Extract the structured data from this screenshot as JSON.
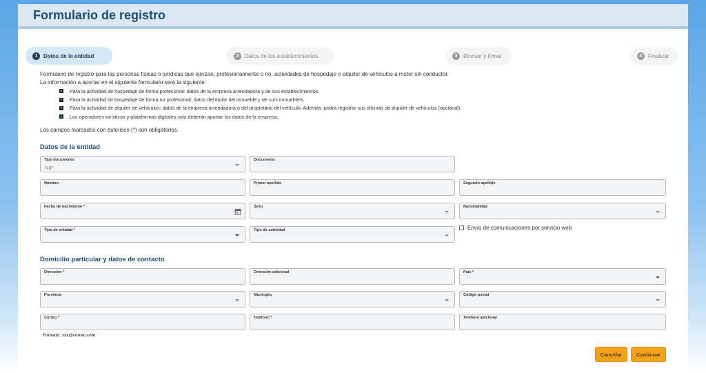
{
  "header": {
    "title": "Formulario de registro"
  },
  "stepper": [
    {
      "num": "1",
      "label": "Datos de la entidad"
    },
    {
      "num": "2",
      "label": "Datos de los establecimientos"
    },
    {
      "num": "3",
      "label": "Revisar y firmar"
    },
    {
      "num": "4",
      "label": "Finalizar"
    }
  ],
  "intro": {
    "line1": "Formulario de registro para las personas físicas o jurídicas que ejerzan, profesionalmente o no, actividades de hospedaje o alquiler de vehículos a motor sin conductor.",
    "line2": "La información a aportar en el siguiente formulario será la siguiente:",
    "bullets": [
      "Para la actividad de hospedaje de forma profesional: datos de la empresa arrendadora y de sus establecimientos.",
      "Para la actividad de hospedaje de forma no profesional: datos del titular del inmueble y de su/s inmueble/s.",
      "Para la actividad de alquiler de vehículos: datos de la empresa arrendadora o del propietario del vehículo. Además, podrá registrar sus oficinas de alquiler de vehículos (opcional).",
      "Los operadores turísticos y plataformas digitales solo deberán aportar los datos de la empresa."
    ],
    "note": "Los campos marcados con asterisco (*) son obligatorios."
  },
  "entity": {
    "title": "Datos de la entidad",
    "tipo_documento": {
      "label": "Tipo documento",
      "value": "NIF"
    },
    "documento": {
      "label": "Documento"
    },
    "nombre": {
      "label": "Nombre"
    },
    "primer_apellido": {
      "label": "Primer apellido"
    },
    "segundo_apellido": {
      "label": "Segundo apellido"
    },
    "fecha_nacimiento": {
      "label": "Fecha de nacimiento *",
      "icon": "calendar-icon"
    },
    "sexo": {
      "label": "Sexo"
    },
    "nacionalidad": {
      "label": "Nacionalidad"
    },
    "tipo_entidad": {
      "label": "Tipo de entidad *"
    },
    "tipo_actividad": {
      "label": "Tipo de actividad"
    },
    "envio_ws": {
      "label": "Envío de comunicaciones por servicio web",
      "checked": false
    }
  },
  "contact": {
    "title": "Domicilio particular y datos de contacto",
    "direccion": {
      "label": "Dirección *"
    },
    "direccion_adicional": {
      "label": "Dirección adicional"
    },
    "pais": {
      "label": "País *"
    },
    "provincia": {
      "label": "Provincia"
    },
    "municipio": {
      "label": "Municipio"
    },
    "codigo_postal": {
      "label": "Código postal"
    },
    "correo": {
      "label": "Correo *"
    },
    "telefono": {
      "label": "Teléfono *"
    },
    "telefono_adicional": {
      "label": "Teléfono adicional"
    },
    "email_hint": "Formato: xxx@correo.com"
  },
  "actions": {
    "cancel": "Cancelar",
    "continue": "Continuar"
  },
  "colors": {
    "accent": "#1e4d78",
    "button": "#f5a21b",
    "active_step": "#d3e7f5"
  }
}
